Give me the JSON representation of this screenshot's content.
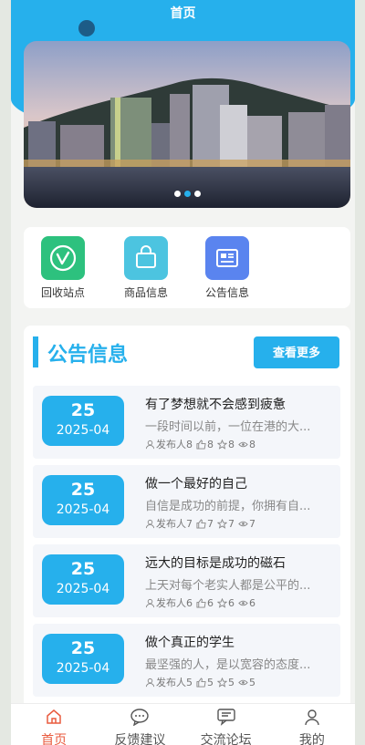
{
  "header": {
    "title": "首页"
  },
  "banner": {
    "indicator_count": 3,
    "active_index": 1
  },
  "quick_links": [
    {
      "label": "回收站点",
      "icon": "recycle-icon",
      "color": "#2dc17e"
    },
    {
      "label": "商品信息",
      "icon": "shopping-bag-icon",
      "color": "#4cc4e0"
    },
    {
      "label": "公告信息",
      "icon": "news-icon",
      "color": "#5a84ef"
    }
  ],
  "notice": {
    "title": "公告信息",
    "more_label": "查看更多",
    "items": [
      {
        "day": "25",
        "month": "2025-04",
        "title": "有了梦想就不会感到疲惫",
        "desc": "一段时间以前，一位在港的大...",
        "publisher": "发布人8",
        "likes": "8",
        "favorites": "8",
        "views": "8"
      },
      {
        "day": "25",
        "month": "2025-04",
        "title": "做一个最好的自己",
        "desc": "自信是成功的前提，你拥有自...",
        "publisher": "发布人7",
        "likes": "7",
        "favorites": "7",
        "views": "7"
      },
      {
        "day": "25",
        "month": "2025-04",
        "title": "远大的目标是成功的磁石",
        "desc": "上天对每个老实人都是公平的...",
        "publisher": "发布人6",
        "likes": "6",
        "favorites": "6",
        "views": "6"
      },
      {
        "day": "25",
        "month": "2025-04",
        "title": "做个真正的学生",
        "desc": "最坚强的人，是以宽容的态度...",
        "publisher": "发布人5",
        "likes": "5",
        "favorites": "5",
        "views": "5"
      }
    ]
  },
  "tabbar": [
    {
      "label": "首页",
      "icon": "home-icon",
      "active": true
    },
    {
      "label": "反馈建议",
      "icon": "chat-bubble-icon",
      "active": false
    },
    {
      "label": "交流论坛",
      "icon": "forum-icon",
      "active": false
    },
    {
      "label": "我的",
      "icon": "user-icon",
      "active": false
    }
  ],
  "colors": {
    "accent": "#26b0ec",
    "tab_active": "#e95b3f"
  }
}
